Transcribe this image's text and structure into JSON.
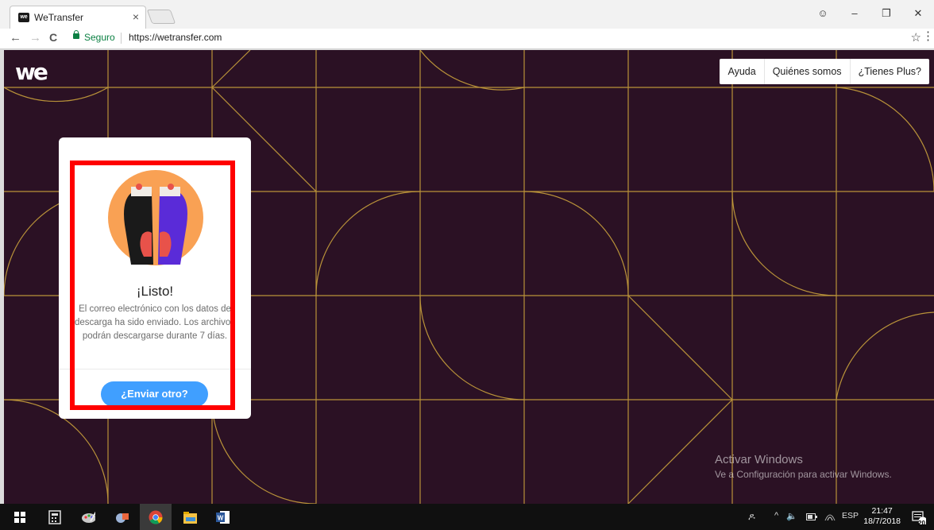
{
  "browser": {
    "tab_title": "WeTransfer",
    "tab_close": "×",
    "favicon_text": "we",
    "secure_label": "Seguro",
    "url": "https://wetransfer.com",
    "back": "←",
    "forward": "→",
    "reload": "C",
    "bookmark": "☆",
    "menu": "⋮",
    "profile": "☺",
    "minimize": "–",
    "restore": "❐",
    "close": "✕"
  },
  "header": {
    "logo": "we",
    "nav": [
      "Ayuda",
      "Quiénes somos",
      "¿Tienes Plus?"
    ]
  },
  "panel": {
    "title": "¡Listo!",
    "message": "El correo electrónico con los datos de descarga ha sido enviado. Los archivos podrán descargarse durante 7 días.",
    "button": "¿Enviar otro?"
  },
  "watermark": {
    "title": "Activar Windows",
    "subtitle": "Ve a Configuración para activar Windows."
  },
  "taskbar": {
    "tray_people": "ዶ",
    "tray_chevron": "^",
    "tray_volume": "🔈",
    "tray_lang": "ESP",
    "time": "21:47",
    "date": "18/7/2018",
    "notifications": "20"
  },
  "colors": {
    "background": "#2b1124",
    "pattern_line": "#c9a13c",
    "button": "#409fff",
    "highlight": "#ff0000"
  }
}
